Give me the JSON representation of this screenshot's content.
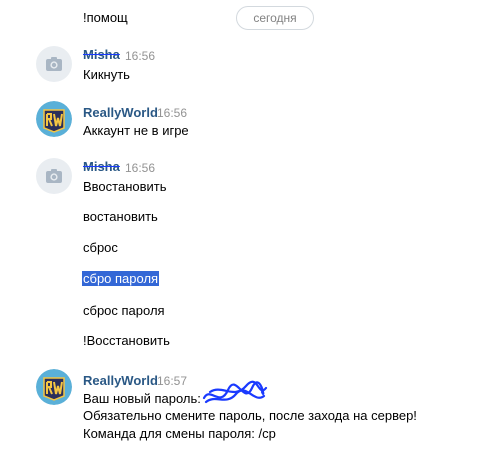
{
  "date_separator": "сегодня",
  "messages": [
    {
      "text": "!помощ"
    },
    {
      "author": "Misha",
      "time": "16:56",
      "text": "Кикнуть",
      "avatar_icon": "camera-icon"
    },
    {
      "author": "ReallyWorld",
      "time": "16:56",
      "text": "Аккаунт не в игре",
      "avatar_icon": "reallyworld-logo"
    },
    {
      "author": "Misha",
      "time": "16:56",
      "avatar_icon": "camera-icon",
      "lines": [
        "Ввостановить",
        "востановить",
        "сброс",
        "сбро пароля",
        "сброс пароля",
        "!Восстановить"
      ]
    },
    {
      "author": "ReallyWorld",
      "time": "16:57",
      "avatar_icon": "reallyworld-logo",
      "lines": [
        "Ваш новый пароль:",
        "Обязательно смените пароль, после захода на сервер!",
        "Команда для смены пароля: /cp"
      ]
    }
  ],
  "colors": {
    "author": "#2a5885",
    "time": "#939393",
    "selection": "#3367d6",
    "scribble": "#1a3aff"
  }
}
